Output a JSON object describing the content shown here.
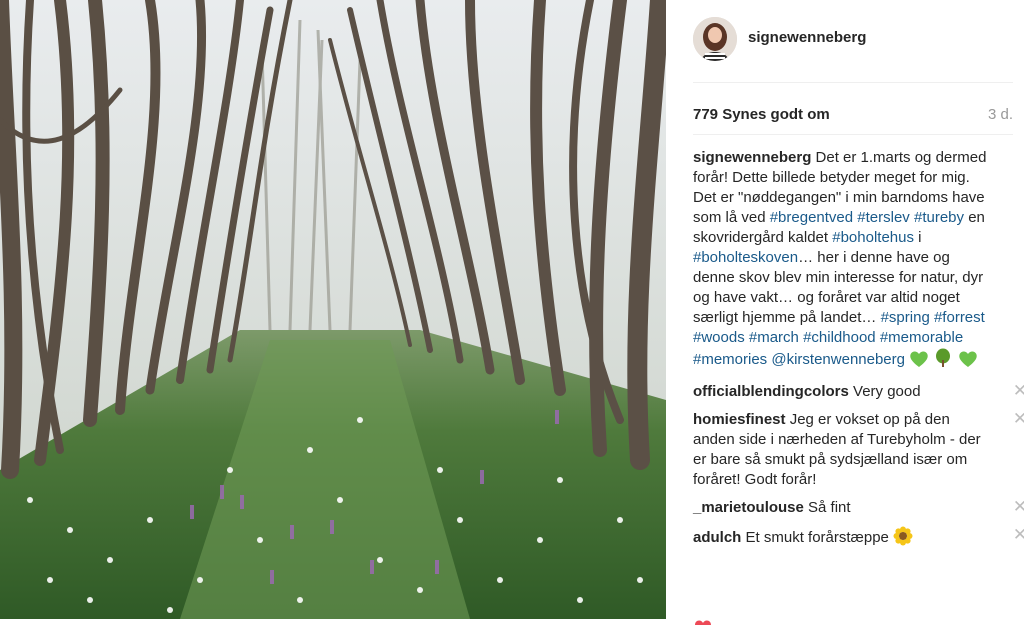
{
  "post": {
    "author": "signewenneberg",
    "likes": "779 Synes godt om",
    "time": "3 d."
  },
  "caption": {
    "user": "signewenneberg",
    "text_1": " Det er 1.marts og dermed forår! Dette billede betyder meget for mig. Det er \"nøddegangen\" i min barndoms have som lå ved ",
    "tag_bregentved": "#bregentved",
    "tag_terslev": "#terslev",
    "tag_tureby": "#tureby",
    "text_2": " en skovridergård kaldet ",
    "tag_boholtehus": "#boholtehus",
    "text_3": " i ",
    "tag_boholteskoven": "#boholteskoven",
    "text_4": "… her i denne have og denne skov blev min interesse for natur, dyr og have vakt… og foråret var altid noget særligt hjemme på landet…",
    "tag_spring": "#spring",
    "tag_forrest": "#forrest",
    "tag_woods": "#woods",
    "tag_march": "#march",
    "tag_childhood": "#childhood",
    "tag_memorable": "#memorable",
    "tag_memories": "#memories",
    "mention_kirsten": "@kirstenwenneberg"
  },
  "comments": [
    {
      "user": "officialblendingcolors",
      "text": " Very good"
    },
    {
      "user": "homiesfinest",
      "text": " Jeg er vokset op på den anden side i nærheden af Turebyholm - der er bare så smukt på sydsjælland især om foråret! Godt forår!"
    },
    {
      "user": "_marietoulouse",
      "text": " Så fint"
    },
    {
      "user": "adulch",
      "text": " Et smukt forårstæppe"
    }
  ],
  "icons": {
    "close": "close-icon",
    "heart": "heart-icon",
    "emoji_green_heart": "green-heart-emoji",
    "emoji_tree": "deciduous-tree-emoji",
    "emoji_sunflower": "sunflower-emoji"
  },
  "colors": {
    "hashtag": "#1a5a8a",
    "muted": "#999999",
    "divider": "#efefef"
  }
}
